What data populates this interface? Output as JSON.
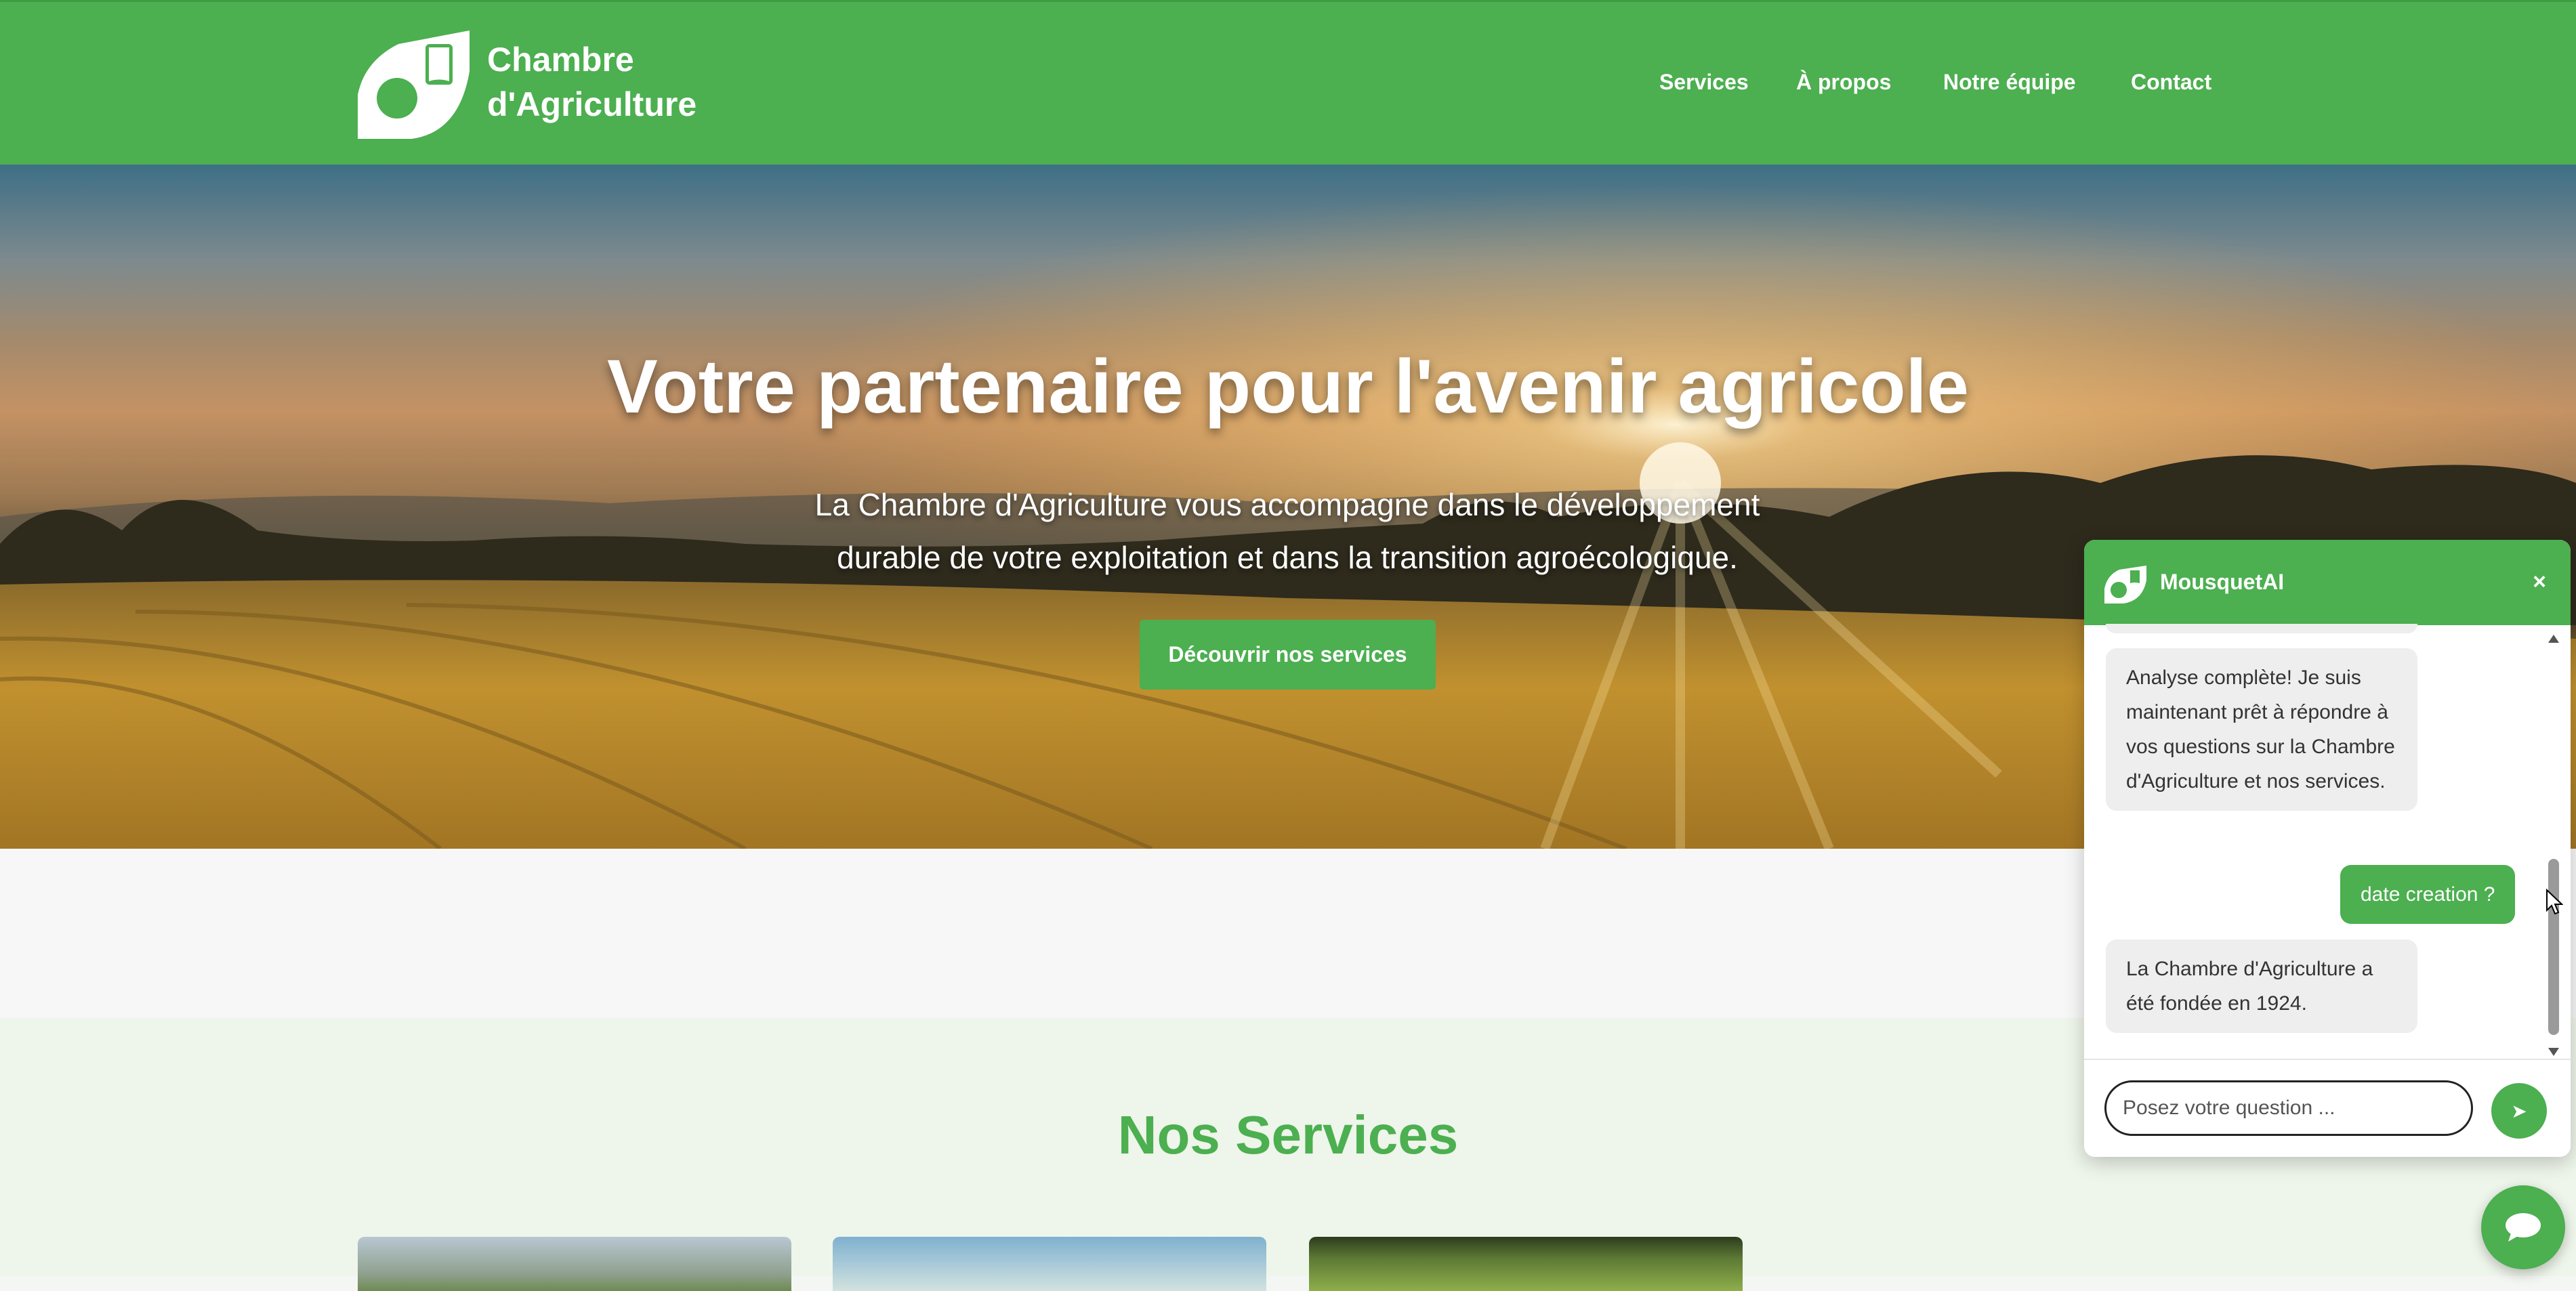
{
  "header": {
    "brand_line1": "Chambre",
    "brand_line2": "d'Agriculture",
    "nav": [
      "Services",
      "À propos",
      "Notre équipe",
      "Contact"
    ]
  },
  "hero": {
    "title": "Votre partenaire pour l'avenir agricole",
    "subtitle_line1": "La Chambre d'Agriculture vous accompagne dans le développement",
    "subtitle_line2": "durable de votre exploitation et dans la transition agroécologique.",
    "cta_label": "Découvrir nos services"
  },
  "services": {
    "title": "Nos Services"
  },
  "chat": {
    "title": "MousquetAI",
    "close_label": "×",
    "messages": [
      {
        "role": "bot",
        "text": "Analyse complète! Je suis maintenant prêt à répondre à vos questions sur la Chambre d'Agriculture et nos services."
      },
      {
        "role": "user",
        "text": "date creation ?"
      },
      {
        "role": "bot",
        "text": "La Chambre d'Agriculture a été fondée en 1924."
      }
    ],
    "input_placeholder": "Posez votre question ...",
    "send_label": "➤"
  },
  "colors": {
    "brand_green": "#4caf50",
    "section_bg": "#eef5ea",
    "bot_bubble": "#eeeeee"
  },
  "icons": {
    "logo": "leaf-logo-icon",
    "send": "send-icon",
    "launcher": "chat-bubble-icon",
    "close": "close-icon"
  }
}
